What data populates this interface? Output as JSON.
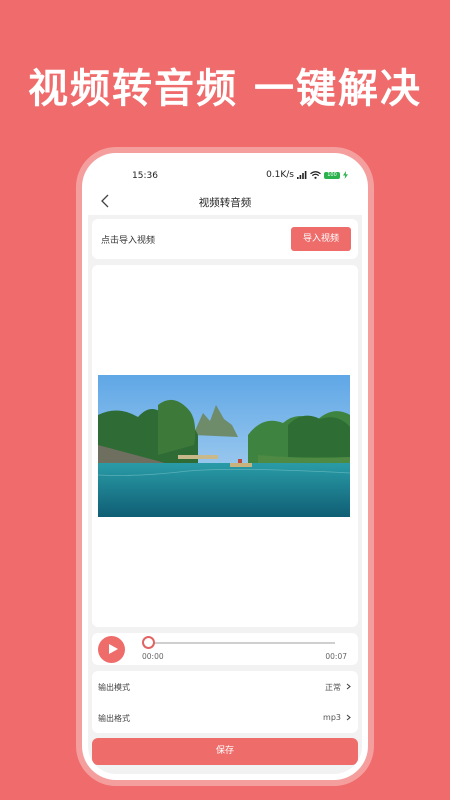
{
  "headline": "视频转音频 一键解决",
  "status": {
    "time": "15:36",
    "speed": "0.1K/s",
    "battery": "100"
  },
  "nav": {
    "title": "视频转音频"
  },
  "import": {
    "label": "点击导入视频",
    "button": "导入视频"
  },
  "player": {
    "current_time": "00:00",
    "total_time": "00:07",
    "progress": 0
  },
  "settings": [
    {
      "label": "输出模式",
      "value": "正常"
    },
    {
      "label": "输出格式",
      "value": "mp3"
    }
  ],
  "save_label": "保存",
  "colors": {
    "brand": "#F06B6B",
    "button": "#EE6D6B"
  }
}
